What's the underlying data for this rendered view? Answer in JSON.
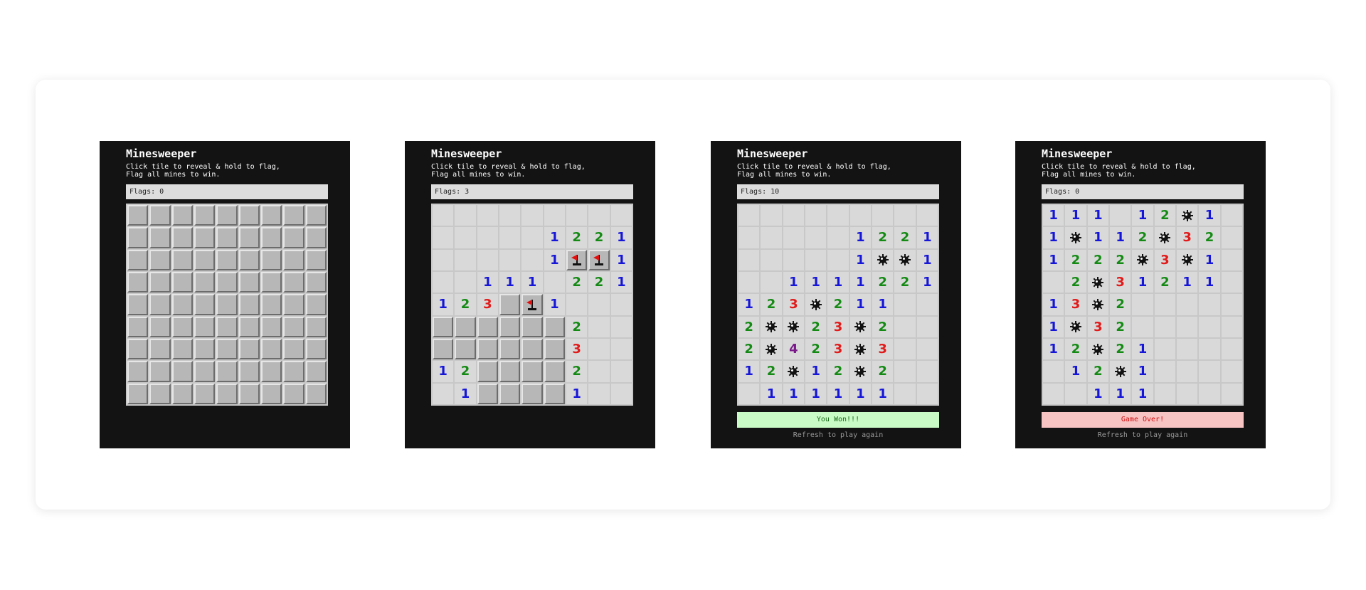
{
  "panels": [
    {
      "title": "Minesweeper",
      "instructions": "Click tile to reveal & hold to flag,\nFlag all mines to win.",
      "flags_label": "Flags: 0",
      "board": [
        "#########",
        "#########",
        "#########",
        "#########",
        "#########",
        "#########",
        "#########",
        "#########",
        "#########"
      ],
      "banner": null,
      "refresh": null
    },
    {
      "title": "Minesweeper",
      "instructions": "Click tile to reveal & hold to flag,\nFlag all mines to win.",
      "flags_label": "Flags: 3",
      "board": [
        ".........",
        ".....1221",
        ".....1FF1",
        "..111.221",
        "123#F1...",
        "######2..",
        "######3..",
        "12####2..",
        ".1####1.."
      ],
      "banner": null,
      "refresh": null
    },
    {
      "title": "Minesweeper",
      "instructions": "Click tile to reveal & hold to flag,\nFlag all mines to win.",
      "flags_label": "Flags: 10",
      "board": [
        ".........",
        ".....1221",
        ".....1MM1",
        "..1111221",
        "123M211..",
        "2MM23M2..",
        "2M423M3..",
        "12M12M2..",
        ".111111.."
      ],
      "banner": {
        "text": "You Won!!!",
        "type": "won"
      },
      "refresh": "Refresh to play again"
    },
    {
      "title": "Minesweeper",
      "instructions": "Click tile to reveal & hold to flag,\nFlag all mines to win.",
      "flags_label": "Flags: 0",
      "board": [
        "111.12M1.",
        "1M112M32.",
        "1222M3M1.",
        ".2M31211.",
        "13M2.....",
        "1M32.....",
        "12M21....",
        ".12M1....",
        "..111...."
      ],
      "banner": {
        "text": "Game Over!",
        "type": "lost"
      },
      "refresh": "Refresh to play again"
    }
  ],
  "icons": {
    "mine": "mine-icon",
    "flag": "flag-icon"
  },
  "colors": {
    "panel_bg": "#131313",
    "number_1": "#1616d8",
    "number_2": "#148a14",
    "number_3": "#e11a1a",
    "number_4": "#7a1a8a",
    "won_banner": "#c9fbc6",
    "lost_banner": "#f8c3c3"
  }
}
